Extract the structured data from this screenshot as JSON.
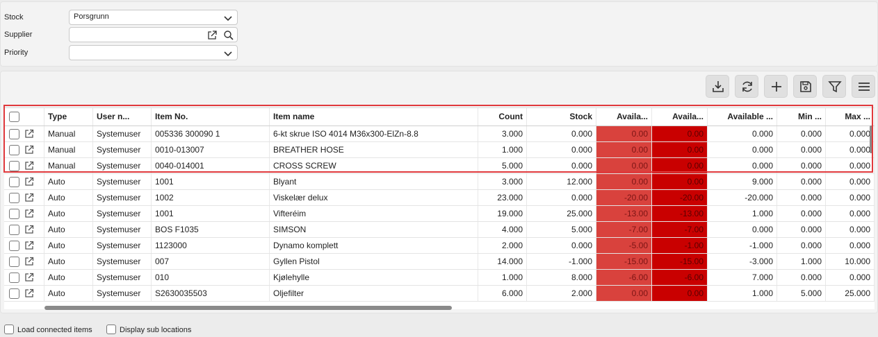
{
  "filters": {
    "stock_label": "Stock",
    "stock_value": "Porsgrunn",
    "supplier_label": "Supplier",
    "supplier_value": "",
    "priority_label": "Priority",
    "priority_value": ""
  },
  "toolbar": [
    "download-icon",
    "refresh-icon",
    "plus-icon",
    "save-icon",
    "filter-icon",
    "menu-icon"
  ],
  "columns": [
    "",
    "Type",
    "User n...",
    "Item No.",
    "Item name",
    "Count",
    "Stock",
    "Availa...",
    "Availa...",
    "Available ...",
    "Min ...",
    "Max ..."
  ],
  "rows": [
    {
      "type": "Manual",
      "user": "Systemuser",
      "item_no": "005336 300090 1",
      "item_name": "6-kt skrue ISO 4014 M36x300-ElZn-8.8",
      "count": "3.000",
      "stock": "0.000",
      "avail1": "0.00",
      "avail2": "0.00",
      "available": "0.000",
      "min": "0.000",
      "max": "0.000"
    },
    {
      "type": "Manual",
      "user": "Systemuser",
      "item_no": "0010-013007",
      "item_name": "BREATHER HOSE",
      "count": "1.000",
      "stock": "0.000",
      "avail1": "0.00",
      "avail2": "0.00",
      "available": "0.000",
      "min": "0.000",
      "max": "0.000"
    },
    {
      "type": "Manual",
      "user": "Systemuser",
      "item_no": "0040-014001",
      "item_name": "CROSS SCREW",
      "count": "5.000",
      "stock": "0.000",
      "avail1": "0.00",
      "avail2": "0.00",
      "available": "0.000",
      "min": "0.000",
      "max": "0.000"
    },
    {
      "type": "Auto",
      "user": "Systemuser",
      "item_no": "1001",
      "item_name": "Blyant",
      "count": "3.000",
      "stock": "12.000",
      "avail1": "0.00",
      "avail2": "0.00",
      "available": "9.000",
      "min": "0.000",
      "max": "0.000"
    },
    {
      "type": "Auto",
      "user": "Systemuser",
      "item_no": "1002",
      "item_name": "Viskelær delux",
      "count": "23.000",
      "stock": "0.000",
      "avail1": "-20.00",
      "avail2": "-20.00",
      "available": "-20.000",
      "min": "0.000",
      "max": "0.000"
    },
    {
      "type": "Auto",
      "user": "Systemuser",
      "item_no": "1001",
      "item_name": "Vifteréim",
      "count": "19.000",
      "stock": "25.000",
      "avail1": "-13.00",
      "avail2": "-13.00",
      "available": "1.000",
      "min": "0.000",
      "max": "0.000"
    },
    {
      "type": "Auto",
      "user": "Systemuser",
      "item_no": "BOS F1035",
      "item_name": "SIMSON",
      "count": "4.000",
      "stock": "5.000",
      "avail1": "-7.00",
      "avail2": "-7.00",
      "available": "0.000",
      "min": "0.000",
      "max": "0.000"
    },
    {
      "type": "Auto",
      "user": "Systemuser",
      "item_no": "1123000",
      "item_name": "Dynamo komplett",
      "count": "2.000",
      "stock": "0.000",
      "avail1": "-5.00",
      "avail2": "-1.00",
      "available": "-1.000",
      "min": "0.000",
      "max": "0.000"
    },
    {
      "type": "Auto",
      "user": "Systemuser",
      "item_no": "007",
      "item_name": "Gyllen Pistol",
      "count": "14.000",
      "stock": "-1.000",
      "avail1": "-15.00",
      "avail2": "-15.00",
      "available": "-3.000",
      "min": "1.000",
      "max": "10.000"
    },
    {
      "type": "Auto",
      "user": "Systemuser",
      "item_no": "010",
      "item_name": "Kjølehylle",
      "count": "1.000",
      "stock": "8.000",
      "avail1": "-6.00",
      "avail2": "-6.00",
      "available": "7.000",
      "min": "0.000",
      "max": "0.000"
    },
    {
      "type": "Auto",
      "user": "Systemuser",
      "item_no": "S2630035503",
      "item_name": "Oljefilter",
      "count": "6.000",
      "stock": "2.000",
      "avail1": "0.00",
      "avail2": "0.00",
      "available": "1.000",
      "min": "5.000",
      "max": "25.000"
    }
  ],
  "bottom": {
    "load_connected": "Load connected items",
    "display_sub": "Display sub locations"
  }
}
